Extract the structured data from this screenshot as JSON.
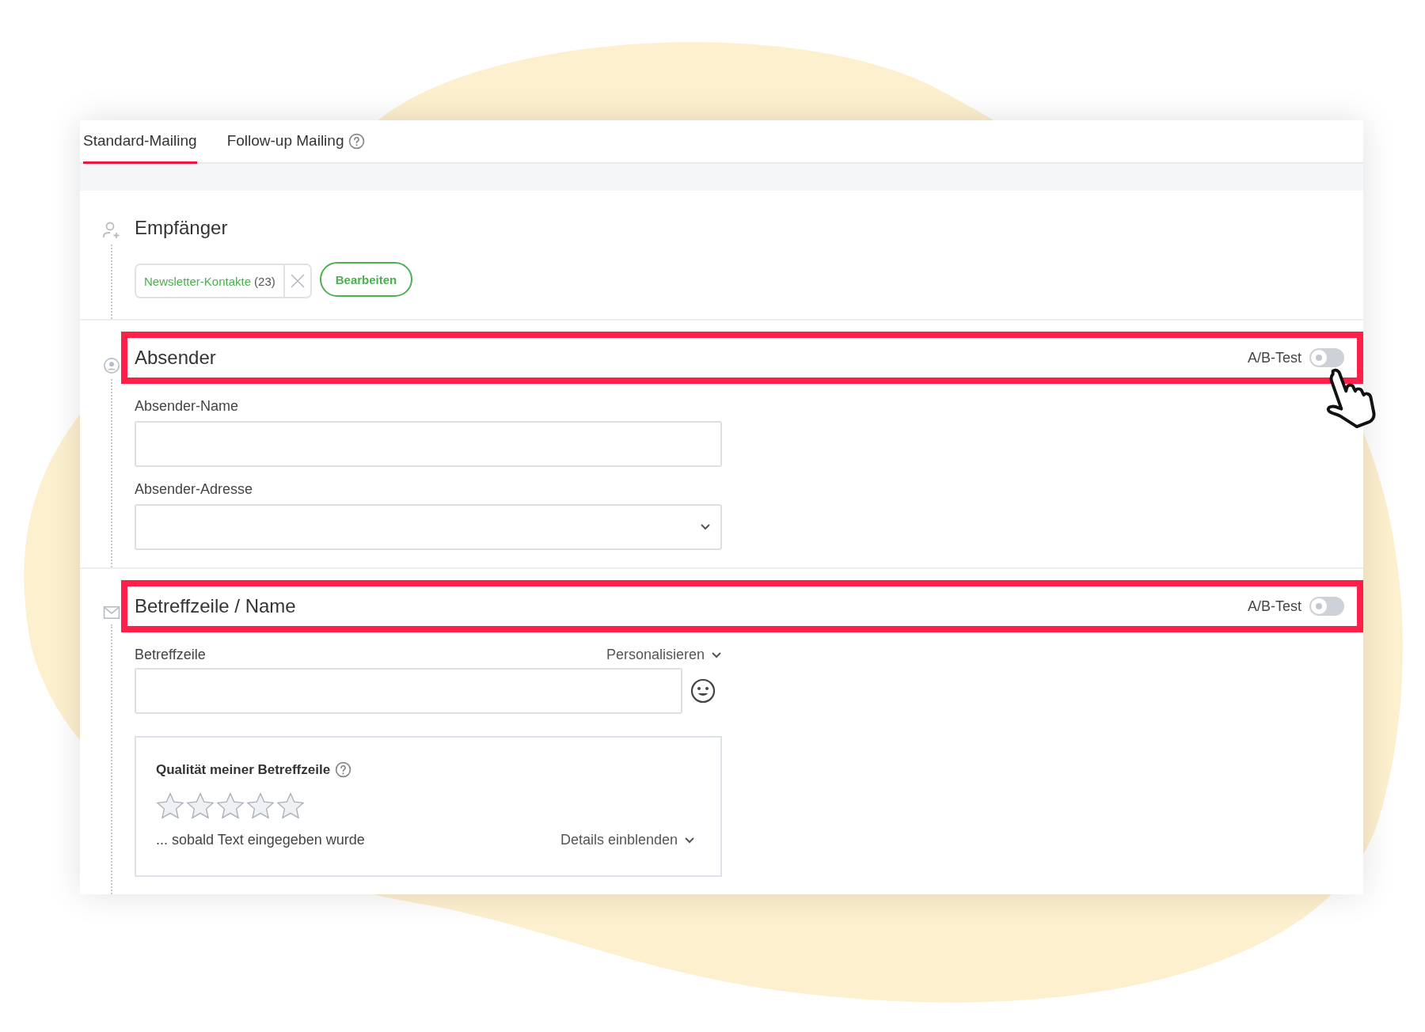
{
  "tabs": [
    {
      "label": "Standard-Mailing",
      "selected": true,
      "help": false
    },
    {
      "label": "Follow-up Mailing",
      "selected": false,
      "help": true
    }
  ],
  "sections": [
    {
      "kind": "recipients",
      "title": "Empfänger",
      "list": {
        "name": "Newsletter-Kontakte",
        "count": "(23)"
      },
      "edit_button": "Bearbeiten"
    },
    {
      "kind": "sender",
      "title": "Absender",
      "highlighted": true,
      "ab_test": {
        "label": "A/B-Test",
        "on": false
      },
      "fields": [
        {
          "label": "Absender-Name",
          "kind": "text"
        },
        {
          "label": "Absender-Adresse",
          "kind": "select"
        }
      ]
    },
    {
      "kind": "subject",
      "title": "Betreffzeile / Name",
      "highlighted": true,
      "ab_test": {
        "label": "A/B-Test",
        "on": false
      },
      "field": {
        "label": "Betreffzeile",
        "action": "Personalisieren"
      },
      "quality": {
        "title": "Qualität meiner Betreffzeile",
        "stars": 0,
        "hint": "... sobald Text eingegeben wurde",
        "details": "Details einblenden"
      }
    }
  ]
}
